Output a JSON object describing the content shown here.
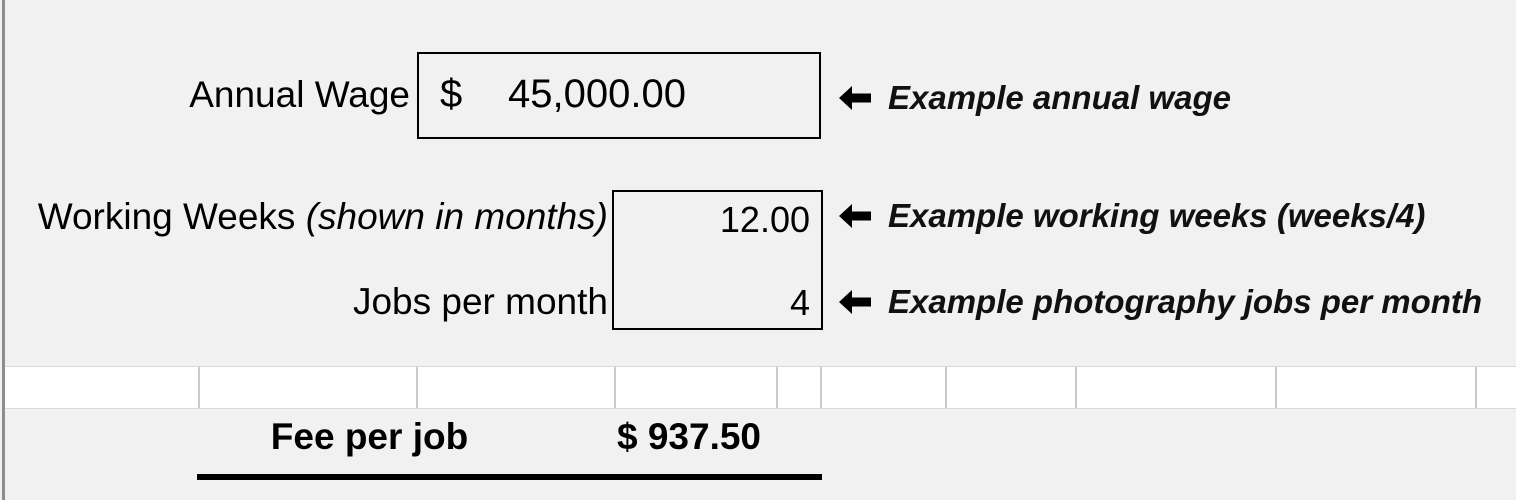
{
  "sheet": {
    "background_color": "#f1f1f1",
    "grid_band_color": "#ffffff",
    "divider_color": "#c9c9c9",
    "rule_color": "#8d8d8d",
    "text_color": "#000000"
  },
  "fields": [
    {
      "id": "annual-wage",
      "label": "Annual Wage",
      "label_paren": "",
      "currency_symbol": "$",
      "value": "45,000.00",
      "annotation": "Example annual wage",
      "annotation_icon": "left-arrow-icon"
    },
    {
      "id": "working-weeks",
      "label": "Working Weeks ",
      "label_paren": "(shown in months)",
      "currency_symbol": "",
      "value": "12.00",
      "annotation": "Example working weeks (weeks/4)",
      "annotation_icon": "left-arrow-icon"
    },
    {
      "id": "jobs-per-month",
      "label": "Jobs per month",
      "label_paren": "",
      "currency_symbol": "",
      "value": "4",
      "annotation": "Example photography jobs per month",
      "annotation_icon": "left-arrow-icon"
    }
  ],
  "total": {
    "label": "Fee per job",
    "value": "$ 937.50"
  },
  "grid": {
    "divider_positions": [
      198,
      416,
      614,
      776,
      820,
      945,
      1075,
      1275,
      1475
    ]
  }
}
